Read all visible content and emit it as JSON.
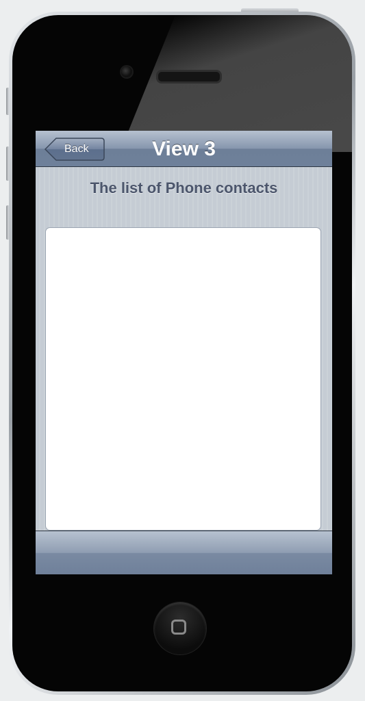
{
  "navbar": {
    "back_label": "Back",
    "title": "View 3"
  },
  "content": {
    "heading": "The list of Phone contacts",
    "contacts": []
  },
  "colors": {
    "navbar": "#8696ad",
    "heading_text": "#4c566c",
    "list_background": "#ffffff"
  },
  "icons": {
    "back": "chevron-left-icon",
    "home": "home-button-icon"
  }
}
